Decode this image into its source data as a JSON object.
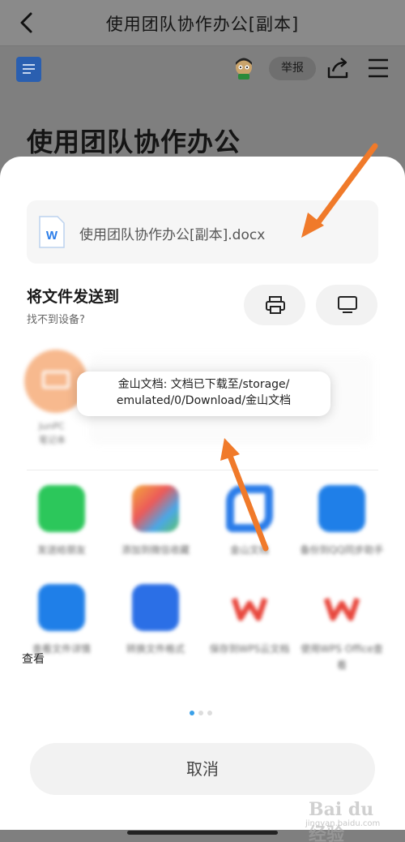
{
  "header": {
    "title": "使用团队协作办公[副本]"
  },
  "toolbar": {
    "report_label": "举报"
  },
  "document": {
    "heading": "使用团队协作办公"
  },
  "sheet": {
    "file_name": "使用团队协作办公[副本].docx",
    "file_icon_letter": "W",
    "send_to_title": "将文件发送到",
    "send_to_subtitle": "找不到设备?",
    "device": {
      "name_line1": "JunPC",
      "name_line2": "笔记本",
      "color": "#f7b98e"
    },
    "apps": [
      {
        "label": "发送给朋友",
        "icon": "wechat-icon",
        "color": "#2cc75b"
      },
      {
        "label": "添加到微信收藏",
        "icon": "cube-icon",
        "color": "#f3a83b"
      },
      {
        "label": "金山文档",
        "icon": "kdocs-icon",
        "color": "#2b7de9"
      },
      {
        "label": "备份到QQ同步助手",
        "icon": "folder-icon",
        "color": "#1f7fe8"
      },
      {
        "label": "查看文件详情",
        "icon": "camera-icon",
        "color": "#1f7fe8"
      },
      {
        "label": "转换文件格式",
        "icon": "convert-icon",
        "color": "#2b6fe6"
      },
      {
        "label": "保存到WPS云文档",
        "icon": "wps-icon",
        "color": "#e8473d"
      },
      {
        "label": "使用WPS Office查看",
        "icon": "wps-icon",
        "color": "#e8473d"
      }
    ],
    "cancel_label": "取消",
    "page_dots": 3,
    "active_dot": 0
  },
  "toast": {
    "line1": "金山文档: 文档已下载至/storage/",
    "line2": "emulated/0/Download/金山文档"
  },
  "overlay_text": "查看",
  "watermark": {
    "logo": "Bai du 经验",
    "url": "jingyan.baidu.com"
  },
  "colors": {
    "accent_arrow": "#f07a2a",
    "dot_active": "#3aa0e8"
  }
}
